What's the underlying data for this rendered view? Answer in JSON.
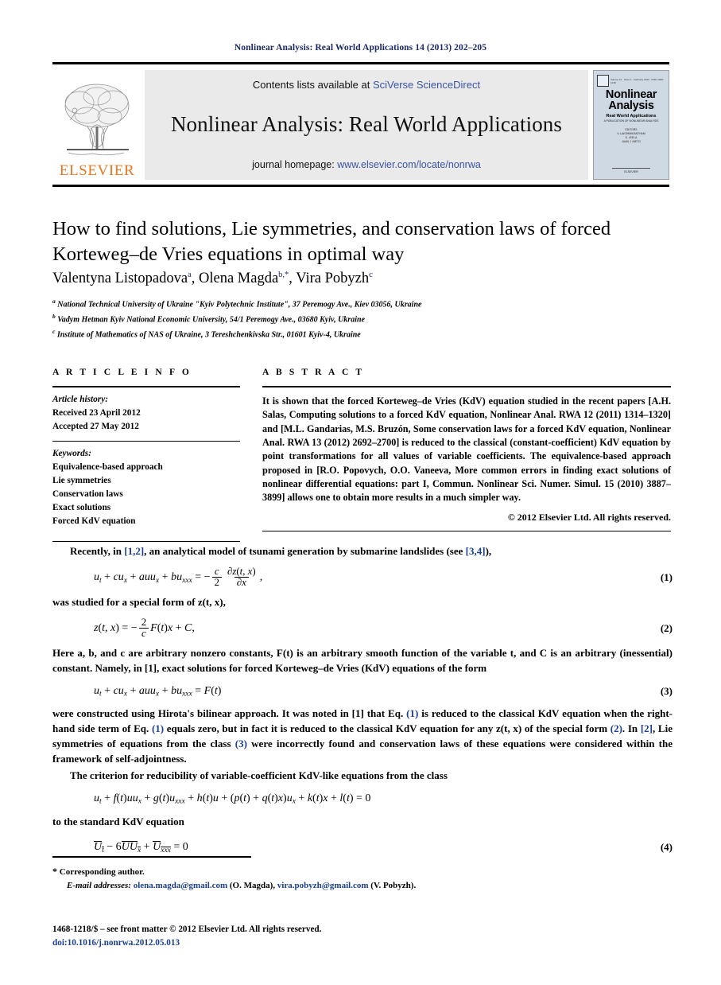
{
  "running_head": "Nonlinear Analysis: Real World Applications 14 (2013) 202–205",
  "masthead": {
    "publisher_name": "ELSEVIER",
    "contents_prefix": "Contents lists available at ",
    "contents_link": "SciVerse ScienceDirect",
    "journal_title": "Nonlinear Analysis: Real World Applications",
    "homepage_prefix": "journal homepage: ",
    "homepage_link": "www.elsevier.com/locate/nonrwa",
    "cover": {
      "title_line1": "Nonlinear",
      "title_line2": "Analysis",
      "subtitle": "Real World Applications",
      "subtitle2": "A PUBLICATION OF NONLINEAR ANALYSIS",
      "editors_label": "EDITORS",
      "editor1": "V. LAKSHMIKANTHAM",
      "editor2": "S. LEELA",
      "editor3": "JUAN J. NIETO",
      "topline": "Volume 14 · Issue 1 · February 2013 · ISSN 1468-1218",
      "footer": "ELSEVIER"
    }
  },
  "article": {
    "title": "How to find solutions, Lie symmetries, and conservation laws of forced Korteweg–de Vries equations in optimal way",
    "authors": [
      {
        "name": "Valentyna Listopadova",
        "marker": "a"
      },
      {
        "name": "Olena Magda",
        "marker": "b,*"
      },
      {
        "name": "Vira Pobyzh",
        "marker": "c"
      }
    ],
    "affiliations": [
      {
        "marker": "a",
        "text": "National Technical University of Ukraine \"Kyiv Polytechnic Institute\", 37 Peremogy Ave., Kiev 03056, Ukraine"
      },
      {
        "marker": "b",
        "text": "Vadym Hetman Kyiv National Economic University, 54/1 Peremogy Ave., 03680 Kyiv, Ukraine"
      },
      {
        "marker": "c",
        "text": "Institute of Mathematics of NAS of Ukraine, 3 Tereshchenkivska Str., 01601 Kyiv-4, Ukraine"
      }
    ]
  },
  "article_info": {
    "heading": "A R T I C L E    I N F O",
    "history_label": "Article history:",
    "received": "Received 23 April 2012",
    "accepted": "Accepted 27 May 2012",
    "keywords_label": "Keywords:",
    "keywords": [
      "Equivalence-based approach",
      "Lie symmetries",
      "Conservation laws",
      "Exact solutions",
      "Forced KdV equation"
    ]
  },
  "abstract": {
    "heading": "A B S T R A C T",
    "text": "It is shown that the forced Korteweg–de Vries (KdV) equation studied in the recent papers [A.H. Salas, Computing solutions to a forced KdV equation, Nonlinear Anal. RWA 12 (2011) 1314–1320] and [M.L. Gandarias, M.S. Bruzón, Some conservation laws for a forced KdV equation, Nonlinear Anal. RWA 13 (2012) 2692–2700] is reduced to the classical (constant-coefficient) KdV equation by point transformations for all values of variable coefficients. The equivalence-based approach proposed in [R.O. Popovych, O.O. Vaneeva, More common errors in finding exact solutions of nonlinear differential equations: part I, Commun. Nonlinear Sci. Numer. Simul. 15 (2010) 3887–3899] allows one to obtain more results in a much simpler way.",
    "copyright": "© 2012 Elsevier Ltd. All rights reserved."
  },
  "body": {
    "para1_a": "Recently, in ",
    "para1_ref1": "[1,2]",
    "para1_b": ", an analytical model of tsunami generation by submarine landslides (see ",
    "para1_ref2": "[3,4]",
    "para1_c": "),",
    "eq1_number": "(1)",
    "after_eq1": "was studied for a special form of z(t, x),",
    "eq2_number": "(2)",
    "para2": "Here a, b, and c are arbitrary nonzero constants, F(t) is an arbitrary smooth function of the variable t, and C is an arbitrary (inessential) constant. Namely, in [1], exact solutions for forced Korteweg–de Vries (KdV) equations of the form",
    "eq3_number": "(3)",
    "para3_a": "were constructed using Hirota's bilinear approach. It was noted in [1] that Eq. ",
    "para3_ref1": "(1)",
    "para3_b": " is reduced to the classical KdV  equation when the right-hand side term of Eq. ",
    "para3_ref2": "(1)",
    "para3_c": " equals zero, but in fact it is reduced to the classical KdV equation for any z(t, x) of the special form ",
    "para3_ref3": "(2)",
    "para3_d": ". In ",
    "para3_ref4": "[2]",
    "para3_e": ", Lie symmetries of equations from the class ",
    "para3_ref5": "(3)",
    "para3_f": " were incorrectly found and conservation laws of these equations were considered within the framework of self-adjointness.",
    "para4": "The criterion for reducibility of variable-coefficient KdV-like equations from the class",
    "after_eq_class": "to the standard KdV equation",
    "eq4_number": "(4)"
  },
  "footnotes": {
    "corresponding": "Corresponding author.",
    "email_label": "E-mail addresses:",
    "email1": "olena.magda@gmail.com",
    "email1_owner": "(O. Magda),",
    "email2": "vira.pobyzh@gmail.com",
    "email2_owner": "(V. Pobyzh).",
    "imprint": "1468-1218/$ – see front matter © 2012 Elsevier Ltd. All rights reserved.",
    "doi": "doi:10.1016/j.nonrwa.2012.05.013"
  },
  "colors": {
    "link": "#1b3f8f",
    "runhead": "#1b2a66",
    "elsevier_orange": "#E87722",
    "banner_bg": "#eaeaea"
  }
}
